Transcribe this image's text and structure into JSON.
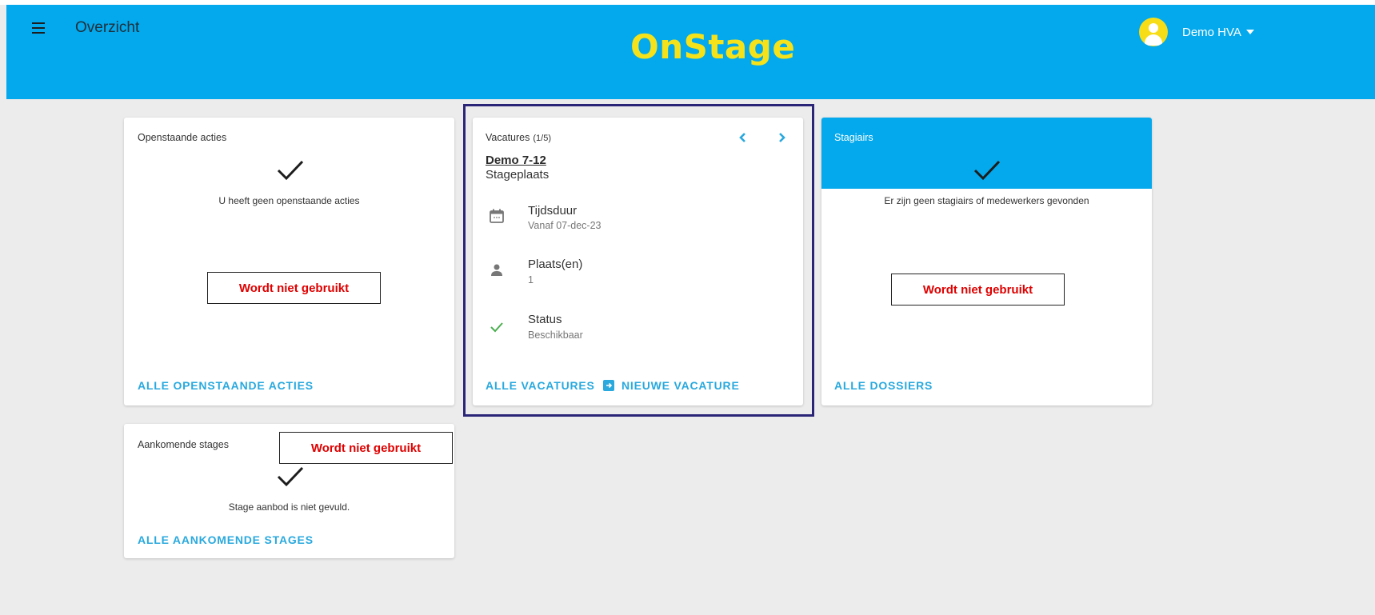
{
  "header": {
    "title": "Overzicht",
    "logo": "OnStage",
    "user_name": "Demo HVA",
    "background": "#03a9ec",
    "logo_color": "#f5e21a"
  },
  "cards": {
    "open_actions": {
      "title": "Openstaande acties",
      "empty_text": "U heeft geen openstaande acties",
      "link": "ALLE OPENSTAANDE ACTIES"
    },
    "vacancies": {
      "title": "Vacatures",
      "counter": "(1/5)",
      "name": "Demo 7-12",
      "type": "Stageplaats",
      "rows": [
        {
          "icon": "calendar-icon",
          "label": "Tijdsduur",
          "value": "Vanaf 07-dec-23"
        },
        {
          "icon": "person-icon",
          "label": "Plaats(en)",
          "value": "1"
        },
        {
          "icon": "check-icon",
          "label": "Status",
          "value": "Beschikbaar"
        }
      ],
      "link_all": "ALLE VACATURES",
      "link_new": "NIEUWE VACATURE"
    },
    "interns": {
      "title": "Stagiairs",
      "empty_text": "Er zijn geen stagiairs of medewerkers gevonden",
      "link": "ALLE DOSSIERS"
    },
    "upcoming": {
      "title": "Aankomende stages",
      "empty_text": "Stage aanbod is niet gevuld.",
      "link": "ALLE AANKOMENDE STAGES"
    }
  },
  "annotations": {
    "label": "Wordt niet gebruikt",
    "color": "#e00000"
  },
  "colors": {
    "link": "#29a9de",
    "highlight_border": "#2b2578",
    "status_check": "#4caf50"
  }
}
